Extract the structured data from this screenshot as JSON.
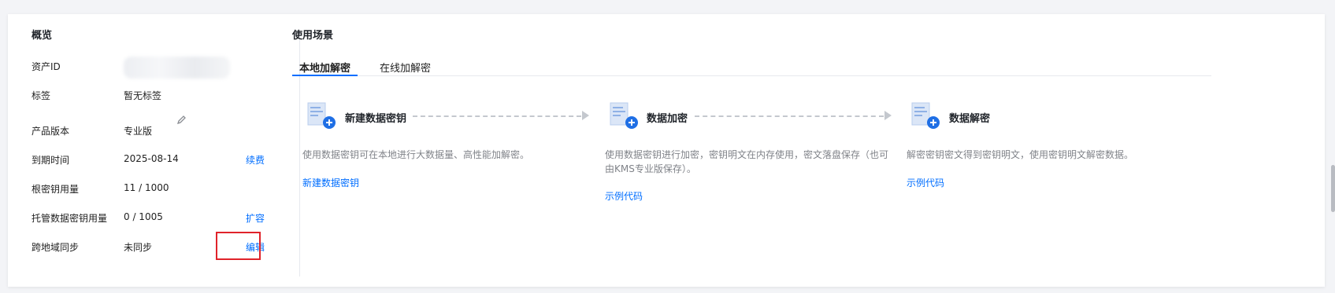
{
  "overview": {
    "title": "概览",
    "rows": [
      {
        "label": "资产ID",
        "value": ""
      },
      {
        "label": "标签",
        "value": "暂无标签"
      },
      {
        "label": "产品版本",
        "value": "专业版"
      },
      {
        "label": "到期时间",
        "value": "2025-08-14",
        "link": "续费"
      },
      {
        "label": "根密钥用量",
        "value": "11 / 1000"
      },
      {
        "label": "托管数据密钥用量",
        "value": "0 / 1005",
        "link": "扩容"
      },
      {
        "label": "跨地域同步",
        "value": "未同步",
        "link": "编辑"
      }
    ]
  },
  "scenarios": {
    "title": "使用场景",
    "tabs": [
      "本地加解密",
      "在线加解密"
    ],
    "active_tab": "本地加解密",
    "steps": [
      {
        "icon": "add-document-icon",
        "title": "新建数据密钥",
        "desc": "使用数据密钥可在本地进行大数据量、高性能加解密。",
        "link": "新建数据密钥"
      },
      {
        "icon": "add-document-icon",
        "title": "数据加密",
        "desc": "使用数据密钥进行加密，密钥明文在内存使用，密文落盘保存（也可由KMS专业版保存）。",
        "link": "示例代码"
      },
      {
        "icon": "add-document-icon",
        "title": "数据解密",
        "desc": "解密密钥密文得到密钥明文，使用密钥明文解密数据。",
        "link": "示例代码"
      }
    ]
  },
  "colors": {
    "accent": "#006eff",
    "highlight_border": "#e0232a"
  }
}
